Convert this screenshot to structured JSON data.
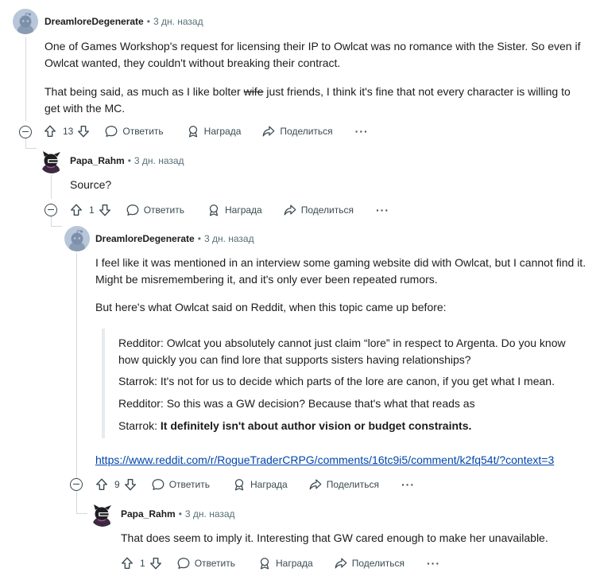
{
  "colors": {
    "link": "#0045ac",
    "muted": "#576f76",
    "text": "#1c1c1c",
    "thread_line": "#d5d9db"
  },
  "actions_labels": {
    "reply": "Ответить",
    "award": "Награда",
    "share": "Поделиться",
    "more": "···"
  },
  "comments": [
    {
      "author": "DreamloreDegenerate",
      "time": "3 дн. назад",
      "avatar": "reddit-snoo-avatar",
      "paragraphs": [
        "One of Games Workshop's request for licensing their IP to Owlcat was no romance with the Sister. So even if Owlcat wanted, they couldn't without breaking their contract."
      ],
      "p2_before": "That being said, as much as I like bolter ",
      "p2_strike": "wife",
      "p2_after": " just friends, I think it's fine that not every character is willing to get with the MC.",
      "votes": "13"
    },
    {
      "author": "Papa_Rahm",
      "time": "3 дн. назад",
      "avatar": "dark-character-avatar",
      "text": "Source?",
      "votes": "1"
    },
    {
      "author": "DreamloreDegenerate",
      "time": "3 дн. назад",
      "avatar": "reddit-snoo-avatar",
      "p1": "I feel like it was mentioned in an interview some gaming website did with Owlcat, but I cannot find it. Might be misremembering it, and it's only ever been repeated rumors.",
      "p2": "But here's what Owlcat said on Reddit, when this topic came up before:",
      "quote": {
        "q1": "Redditor: Owlcat you absolutely cannot just claim “lore” in respect to Argenta. Do you know how quickly you can find lore that supports sisters having relationships?",
        "q2": "Starrok: It's not for us to decide which parts of the lore are canon, if you get what I mean.",
        "q3": "Redditor: So this was a GW decision? Because that's what that reads as",
        "q4_prefix": "Starrok: ",
        "q4_bold": "It definitely isn't about author vision or budget constraints."
      },
      "link": "https://www.reddit.com/r/RogueTraderCRPG/comments/16tc9i5/comment/k2fq54t/?context=3",
      "votes": "9"
    },
    {
      "author": "Papa_Rahm",
      "time": "3 дн. назад",
      "avatar": "dark-character-avatar",
      "text": "That does seem to imply it. Interesting that GW cared enough to make her unavailable.",
      "votes": "1"
    }
  ]
}
